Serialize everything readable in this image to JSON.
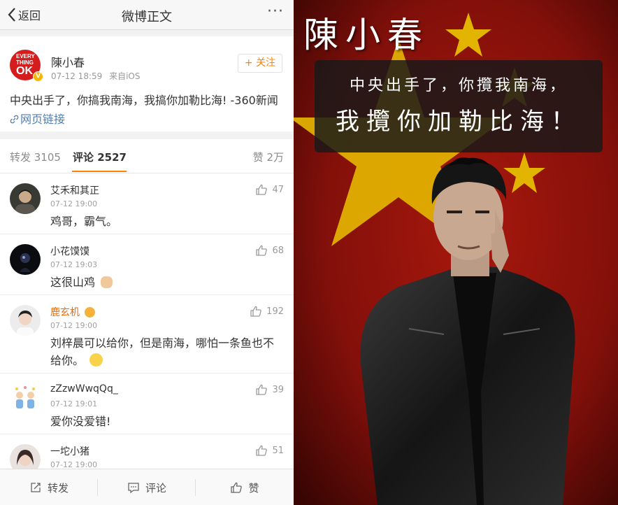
{
  "navbar": {
    "back_label": "返回",
    "title": "微博正文",
    "more_label": "···"
  },
  "post": {
    "author": "陳小春",
    "time": "07-12 18:59",
    "source": "来自iOS",
    "follow_label": "+ 关注",
    "text": "中央出手了，你搞我南海，我搞你加勒比海! -360新闻 ",
    "link_label": "网页链接",
    "avatar_text": {
      "line1": "EVERY",
      "line2": "THING",
      "line3": "OK"
    }
  },
  "tabs": {
    "repost": "转发 3105",
    "comment": "评论 2527",
    "like": "赞 2万"
  },
  "comments": [
    {
      "name": "艾禾和其正",
      "time": "07-12 19:00",
      "text": "鸡哥，霸气。",
      "likes": "47"
    },
    {
      "name": "小花馍馍",
      "time": "07-12 19:03",
      "text": "这很山鸡",
      "likes": "68"
    },
    {
      "name": "鹿玄机",
      "time": "07-12 19:00",
      "text": "刘梓晨可以给你，但是南海，哪怕一条鱼也不给你。",
      "likes": "192"
    },
    {
      "name": "zZzwWwqQq_",
      "time": "07-12 19:01",
      "text": "爱你没爱错!",
      "likes": "39"
    },
    {
      "name": "一坨小猪",
      "time": "07-12 19:00",
      "text": "",
      "likes": "51"
    }
  ],
  "bottom_bar": {
    "repost": "转发",
    "comment": "评论",
    "like": "赞"
  },
  "poster": {
    "name": "陳小春",
    "line1": "中央出手了，你攬我南海，",
    "line2": "我攬你加勒比海！"
  },
  "colors": {
    "accent": "#ff8200",
    "link": "#507daf",
    "flag_red": "#a5150e",
    "star_yellow": "#f6c400"
  }
}
